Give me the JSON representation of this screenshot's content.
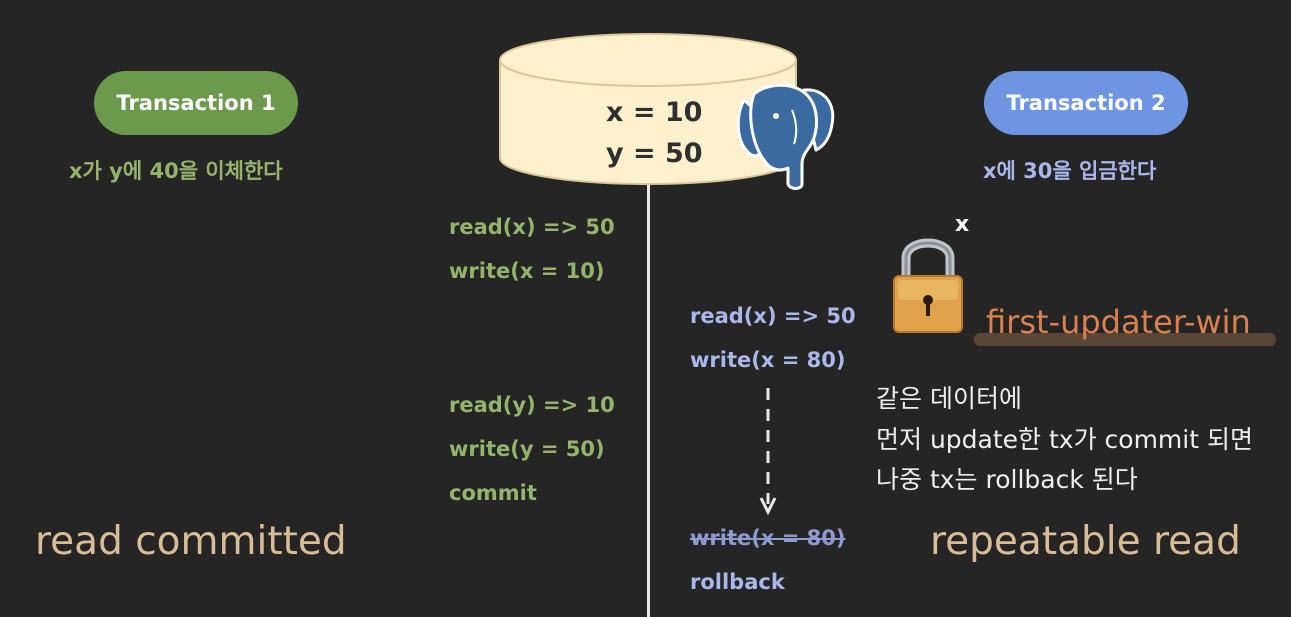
{
  "transaction1": {
    "label": "Transaction 1",
    "description": "x가 y에 40을 이체한다",
    "operations": [
      "read(x) => 50",
      "write(x = 10)",
      "read(y) => 10",
      "write(y = 50)",
      "commit"
    ],
    "isolation_level": "read committed"
  },
  "transaction2": {
    "label": "Transaction 2",
    "description": "x에 30을 입금한다",
    "operations": [
      "read(x) => 50",
      "write(x = 80)"
    ],
    "retried_write": "write(x = 80)",
    "rollback": "rollback",
    "isolation_level": "repeatable read"
  },
  "database": {
    "values": [
      "x = 10",
      "y = 50"
    ],
    "icon": "postgresql-elephant-icon"
  },
  "lock": {
    "label": "x",
    "icon": "padlock-icon",
    "rule": "first-updater-win"
  },
  "explanation": {
    "lines": [
      "같은 데이터에",
      "먼저 update한 tx가 commit 되면",
      "나중 tx는 rollback 된다"
    ]
  },
  "colors": {
    "background": "#262525",
    "transaction1": "#6c9a4c",
    "transaction2": "#6e95e2",
    "database": "#fdf0cc",
    "rule_text": "#d9804c",
    "isolation_text": "#d9bc94"
  }
}
